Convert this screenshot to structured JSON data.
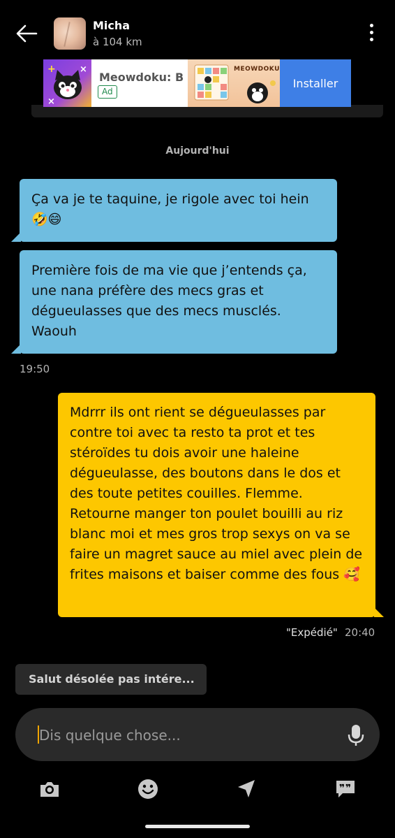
{
  "header": {
    "name": "Micha",
    "distance": "à 104 km"
  },
  "ad": {
    "title": "Meowdoku: Brain",
    "badge": "Ad",
    "banner_logo": "MEOWDOKU",
    "install_label": "Installer",
    "accent": "#3e7fe6"
  },
  "chat": {
    "date_separator": "Aujourd'hui",
    "messages": [
      {
        "direction": "in",
        "text": "Ça va je te taquine, je rigole avec toi hein 🤣😄"
      },
      {
        "direction": "in",
        "text": "Première fois de ma vie que j’entends ça, une nana préfère des mecs gras et dégueulasses que des mecs musclés. Waouh",
        "time": "19:50"
      },
      {
        "direction": "out",
        "text": "Mdrrr ils ont rient se dégueulasses par contre toi avec ta resto ta prot et tes stéroïdes tu dois avoir une haleine dégueulasse, des boutons dans le dos et des toute petites couilles. Flemme. Retourne manger ton poulet bouilli au riz blanc moi et mes gros trop sexys on va se faire un magret sauce au miel avec plein de frites maisons et baiser comme des fous 🥰",
        "status": "\"Expédié\"",
        "time": "20:40"
      }
    ],
    "draft_preview": "Salut désolée pas intére..."
  },
  "composer": {
    "placeholder": "Dis quelque chose..."
  },
  "toolbar": {
    "icons": [
      "camera-icon",
      "smiley-icon",
      "location-icon",
      "quick-reply-icon"
    ]
  },
  "colors": {
    "incoming_bubble": "#6fbde0",
    "outgoing_bubble": "#fdc700",
    "background": "#000000"
  }
}
